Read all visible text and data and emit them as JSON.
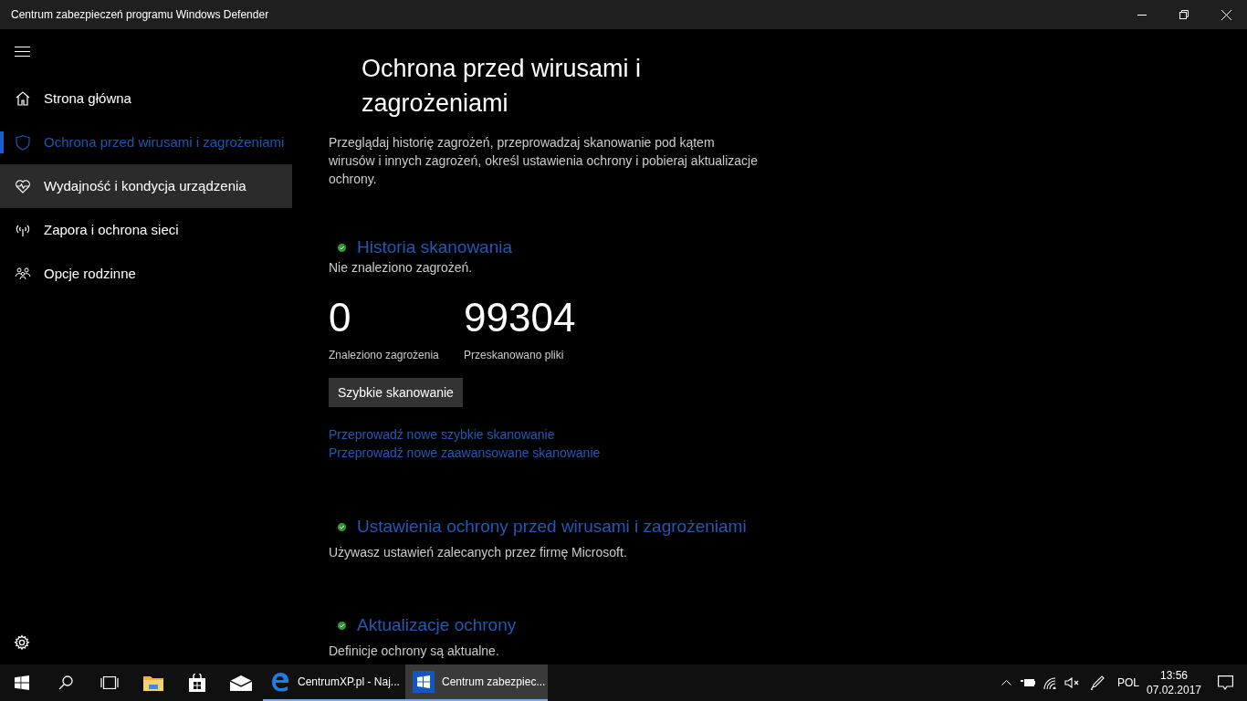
{
  "window": {
    "title": "Centrum zabezpieczeń programu Windows Defender"
  },
  "sidebar": {
    "items": [
      {
        "kind": "home",
        "label": "Strona główna",
        "selected": false,
        "hovered": false
      },
      {
        "kind": "shield",
        "label": "Ochrona przed wirusami i zagrożeniami",
        "selected": true,
        "hovered": false
      },
      {
        "kind": "heart",
        "label": "Wydajność i kondycja urządzenia",
        "selected": false,
        "hovered": true
      },
      {
        "kind": "antenna",
        "label": "Zapora i ochrona sieci",
        "selected": false,
        "hovered": false
      },
      {
        "kind": "family",
        "label": "Opcje rodzinne",
        "selected": false,
        "hovered": false
      }
    ]
  },
  "page": {
    "heading": "Ochrona przed wirusami i zagrożeniami",
    "description": "Przeglądaj historię zagrożeń, przeprowadzaj skanowanie pod kątem wirusów i innych zagrożeń, określ ustawienia ochrony i pobieraj aktualizacje ochrony."
  },
  "scan_history": {
    "title": "Historia skanowania",
    "status": "Nie znaleziono zagrożeń.",
    "stats": [
      {
        "value": "0",
        "label": "Znaleziono zagrożenia"
      },
      {
        "value": "99304",
        "label": "Przeskanowano pliki"
      }
    ],
    "button": "Szybkie skanowanie",
    "links": [
      "Przeprowadź nowe szybkie skanowanie",
      "Przeprowadź nowe zaawansowane skanowanie"
    ]
  },
  "sections": [
    {
      "title": "Ustawienia ochrony przed wirusami i zagrożeniami",
      "status": "Używasz ustawień zalecanych przez firmę Microsoft."
    },
    {
      "title": "Aktualizacje ochrony",
      "status": "Definicje ochrony są aktualne."
    }
  ],
  "taskbar": {
    "apps": [
      {
        "kind": "browser",
        "label": "CentrumXP.pl - Naj...",
        "active": false
      },
      {
        "kind": "security",
        "label": "Centrum zabezpiec...",
        "active": true
      }
    ],
    "language": "POL",
    "time": "13:56",
    "date": "07.02.2017"
  }
}
